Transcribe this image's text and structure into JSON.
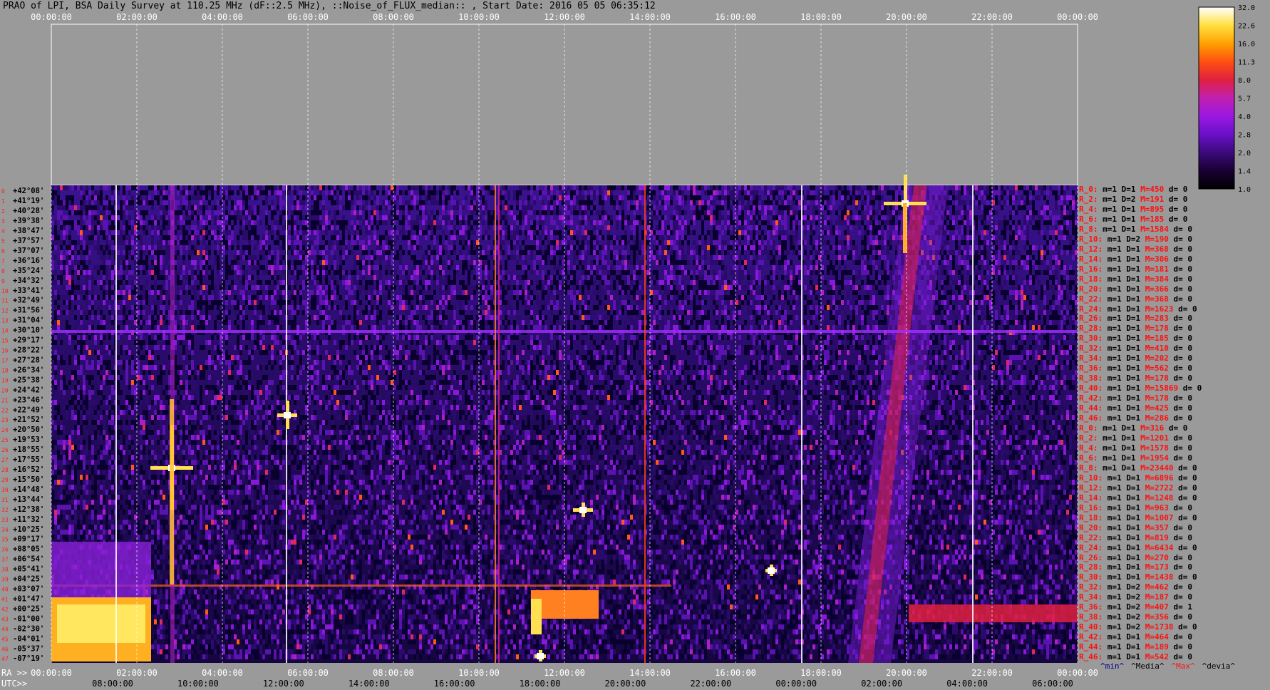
{
  "title": "PRAO of LPI, BSA Daily Survey at 110.25 MHz (dF::2.5 MHz), ::Noise_of_FLUX_median:: , Start Date: 2016 05 05 06:35:12",
  "top_axis_ticks": [
    "00:00:00",
    "02:00:00",
    "04:00:00",
    "06:00:00",
    "08:00:00",
    "10:00:00",
    "12:00:00",
    "14:00:00",
    "16:00:00",
    "18:00:00",
    "20:00:00",
    "22:00:00",
    "00:00:00"
  ],
  "ra_axis": {
    "label": "RA >>",
    "ticks": [
      "00:00:00",
      "02:00:00",
      "04:00:00",
      "06:00:00",
      "08:00:00",
      "10:00:00",
      "12:00:00",
      "14:00:00",
      "16:00:00",
      "18:00:00",
      "20:00:00",
      "22:00:00",
      "00:00:00"
    ]
  },
  "utc_axis": {
    "label": "UTC>>",
    "ticks": [
      "08:00:00",
      "10:00:00",
      "12:00:00",
      "14:00:00",
      "16:00:00",
      "18:00:00",
      "20:00:00",
      "22:00:00",
      "00:00:00",
      "02:00:00",
      "04:00:00",
      "06:00:00"
    ]
  },
  "dec_labels": [
    "+42°08'",
    "+41°19'",
    "+40°28'",
    "+39°38'",
    "+38°47'",
    "+37°57'",
    "+37°07'",
    "+36°16'",
    "+35°24'",
    "+34°32'",
    "+33°41'",
    "+32°49'",
    "+31°56'",
    "+31°04'",
    "+30°10'",
    "+29°17'",
    "+28°22'",
    "+27°28'",
    "+26°34'",
    "+25°38'",
    "+24°42'",
    "+23°46'",
    "+22°49'",
    "+21°52'",
    "+20°50'",
    "+19°53'",
    "+18°55'",
    "+17°55'",
    "+16°52'",
    "+15°50'",
    "+14°48'",
    "+13°44'",
    "+12°38'",
    "+11°32'",
    "+10°25'",
    "+09°17'",
    "+08°05'",
    "+06°54'",
    "+05°41'",
    "+04°25'",
    "+03°07'",
    "+01°47'",
    "+00°25'",
    "-01°00'",
    "-02°30'",
    "-04°01'",
    "-05°37'",
    "-07°19'"
  ],
  "colorbar": {
    "ticks": [
      "32.0",
      "22.6",
      "16.0",
      "11.3",
      "8.0",
      "5.7",
      "4.0",
      "2.8",
      "2.0",
      "1.4",
      "1.0"
    ],
    "colors": [
      "#000000",
      "#1a0033",
      "#3a0a7a",
      "#6a10c8",
      "#9a18e0",
      "#c020b0",
      "#e02040",
      "#ff5010",
      "#ffa000",
      "#ffe040",
      "#ffffff"
    ]
  },
  "stats_rows": [
    {
      "r": "R_0:",
      "m": "m=1",
      "d": "D=1",
      "M": "M=450",
      "dd": "d= 0"
    },
    {
      "r": "R_2:",
      "m": "m=1",
      "d": "D=2",
      "M": "M=191",
      "dd": "d= 0"
    },
    {
      "r": "R_4:",
      "m": "m=1",
      "d": "D=1",
      "M": "M=895",
      "dd": "d= 0"
    },
    {
      "r": "R_6:",
      "m": "m=1",
      "d": "D=1",
      "M": "M=185",
      "dd": "d= 0"
    },
    {
      "r": "R_8:",
      "m": "m=1",
      "d": "D=1",
      "M": "M=1584",
      "dd": "d= 0"
    },
    {
      "r": "R_10:",
      "m": "m=1",
      "d": "D=2",
      "M": "M=190",
      "dd": "d= 0"
    },
    {
      "r": "R_12:",
      "m": "m=1",
      "d": "D=1",
      "M": "M=368",
      "dd": "d= 0"
    },
    {
      "r": "R_14:",
      "m": "m=1",
      "d": "D=1",
      "M": "M=306",
      "dd": "d= 0"
    },
    {
      "r": "R_16:",
      "m": "m=1",
      "d": "D=1",
      "M": "M=181",
      "dd": "d= 0"
    },
    {
      "r": "R_18:",
      "m": "m=1",
      "d": "D=1",
      "M": "M=384",
      "dd": "d= 0"
    },
    {
      "r": "R_20:",
      "m": "m=1",
      "d": "D=1",
      "M": "M=366",
      "dd": "d= 0"
    },
    {
      "r": "R_22:",
      "m": "m=1",
      "d": "D=1",
      "M": "M=368",
      "dd": "d= 0"
    },
    {
      "r": "R_24:",
      "m": "m=1",
      "d": "D=1",
      "M": "M=1623",
      "dd": "d= 0"
    },
    {
      "r": "R_26:",
      "m": "m=1",
      "d": "D=1",
      "M": "M=283",
      "dd": "d= 0"
    },
    {
      "r": "R_28:",
      "m": "m=1",
      "d": "D=1",
      "M": "M=178",
      "dd": "d= 0"
    },
    {
      "r": "R_30:",
      "m": "m=1",
      "d": "D=1",
      "M": "M=185",
      "dd": "d= 0"
    },
    {
      "r": "R_32:",
      "m": "m=1",
      "d": "D=1",
      "M": "M=410",
      "dd": "d= 0"
    },
    {
      "r": "R_34:",
      "m": "m=1",
      "d": "D=1",
      "M": "M=202",
      "dd": "d= 0"
    },
    {
      "r": "R_36:",
      "m": "m=1",
      "d": "D=1",
      "M": "M=562",
      "dd": "d= 0"
    },
    {
      "r": "R_38:",
      "m": "m=1",
      "d": "D=1",
      "M": "M=178",
      "dd": "d= 0"
    },
    {
      "r": "R_40:",
      "m": "m=1",
      "d": "D=1",
      "M": "M=15869",
      "dd": "d= 0"
    },
    {
      "r": "R_42:",
      "m": "m=1",
      "d": "D=1",
      "M": "M=178",
      "dd": "d= 0"
    },
    {
      "r": "R_44:",
      "m": "m=1",
      "d": "D=1",
      "M": "M=425",
      "dd": "d= 0"
    },
    {
      "r": "R_46:",
      "m": "m=1",
      "d": "D=1",
      "M": "M=286",
      "dd": "d= 0"
    },
    {
      "r": "R_0:",
      "m": "m=1",
      "d": "D=1",
      "M": "M=316",
      "dd": "d= 0"
    },
    {
      "r": "R_2:",
      "m": "m=1",
      "d": "D=1",
      "M": "M=1201",
      "dd": "d= 0"
    },
    {
      "r": "R_4:",
      "m": "m=1",
      "d": "D=1",
      "M": "M=1578",
      "dd": "d= 0"
    },
    {
      "r": "R_6:",
      "m": "m=1",
      "d": "D=1",
      "M": "M=1954",
      "dd": "d= 0"
    },
    {
      "r": "R_8:",
      "m": "m=1",
      "d": "D=1",
      "M": "M=23440",
      "dd": "d= 0"
    },
    {
      "r": "R_10:",
      "m": "m=1",
      "d": "D=1",
      "M": "M=6896",
      "dd": "d= 0"
    },
    {
      "r": "R_12:",
      "m": "m=1",
      "d": "D=1",
      "M": "M=2722",
      "dd": "d= 0"
    },
    {
      "r": "R_14:",
      "m": "m=1",
      "d": "D=1",
      "M": "M=1248",
      "dd": "d= 0"
    },
    {
      "r": "R_16:",
      "m": "m=1",
      "d": "D=1",
      "M": "M=963",
      "dd": "d= 0"
    },
    {
      "r": "R_18:",
      "m": "m=1",
      "d": "D=1",
      "M": "M=1007",
      "dd": "d= 0"
    },
    {
      "r": "R_20:",
      "m": "m=1",
      "d": "D=1",
      "M": "M=357",
      "dd": "d= 0"
    },
    {
      "r": "R_22:",
      "m": "m=1",
      "d": "D=1",
      "M": "M=819",
      "dd": "d= 0"
    },
    {
      "r": "R_24:",
      "m": "m=1",
      "d": "D=1",
      "M": "M=6434",
      "dd": "d= 0"
    },
    {
      "r": "R_26:",
      "m": "m=1",
      "d": "D=1",
      "M": "M=270",
      "dd": "d= 0"
    },
    {
      "r": "R_28:",
      "m": "m=1",
      "d": "D=1",
      "M": "M=173",
      "dd": "d= 0"
    },
    {
      "r": "R_30:",
      "m": "m=1",
      "d": "D=1",
      "M": "M=1438",
      "dd": "d= 0"
    },
    {
      "r": "R_32:",
      "m": "m=1",
      "d": "D=2",
      "M": "M=462",
      "dd": "d= 0"
    },
    {
      "r": "R_34:",
      "m": "m=1",
      "d": "D=2",
      "M": "M=187",
      "dd": "d= 0"
    },
    {
      "r": "R_36:",
      "m": "m=1",
      "d": "D=2",
      "M": "M=407",
      "dd": "d= 1"
    },
    {
      "r": "R_38:",
      "m": "m=1",
      "d": "D=2",
      "M": "M=356",
      "dd": "d= 0"
    },
    {
      "r": "R_40:",
      "m": "m=1",
      "d": "D=2",
      "M": "M=1738",
      "dd": "d= 0"
    },
    {
      "r": "R_42:",
      "m": "m=1",
      "d": "D=1",
      "M": "M=464",
      "dd": "d= 0"
    },
    {
      "r": "R_44:",
      "m": "m=1",
      "d": "D=1",
      "M": "M=189",
      "dd": "d= 0"
    },
    {
      "r": "R_46:",
      "m": "m=1",
      "d": "D=1",
      "M": "M=542",
      "dd": "d= 0"
    }
  ],
  "stats_legend": [
    {
      "text": "^min^",
      "color": "#00008b"
    },
    {
      "text": "^Media^",
      "color": "#000000"
    },
    {
      "text": "^Max^",
      "color": "#ff1010"
    },
    {
      "text": "^devia^",
      "color": "#000000"
    }
  ],
  "chart_data": {
    "type": "heatmap",
    "title": "PRAO of LPI, BSA Daily Survey at 110.25 MHz (dF::2.5 MHz), ::Noise_of_FLUX_median:: , Start Date: 2016 05 05 06:35:12",
    "x_axis": "RA / UTC",
    "y_axis": "Declination",
    "color_scale": [
      1.0,
      32.0
    ],
    "rows": 48,
    "features": [
      {
        "desc": "bright source",
        "ra": "03:00",
        "dec": "+16°52'"
      },
      {
        "desc": "bright source",
        "ra": "20:00",
        "dec": "+40°28'"
      },
      {
        "desc": "bright source",
        "ra": "06:00",
        "dec": "+21°52'"
      },
      {
        "desc": "bright source",
        "ra": "12:30",
        "dec": "+12°38'"
      },
      {
        "desc": "bright band",
        "ra": "00:00-02:30",
        "dec": "+00°25' to -02°30'"
      }
    ]
  }
}
